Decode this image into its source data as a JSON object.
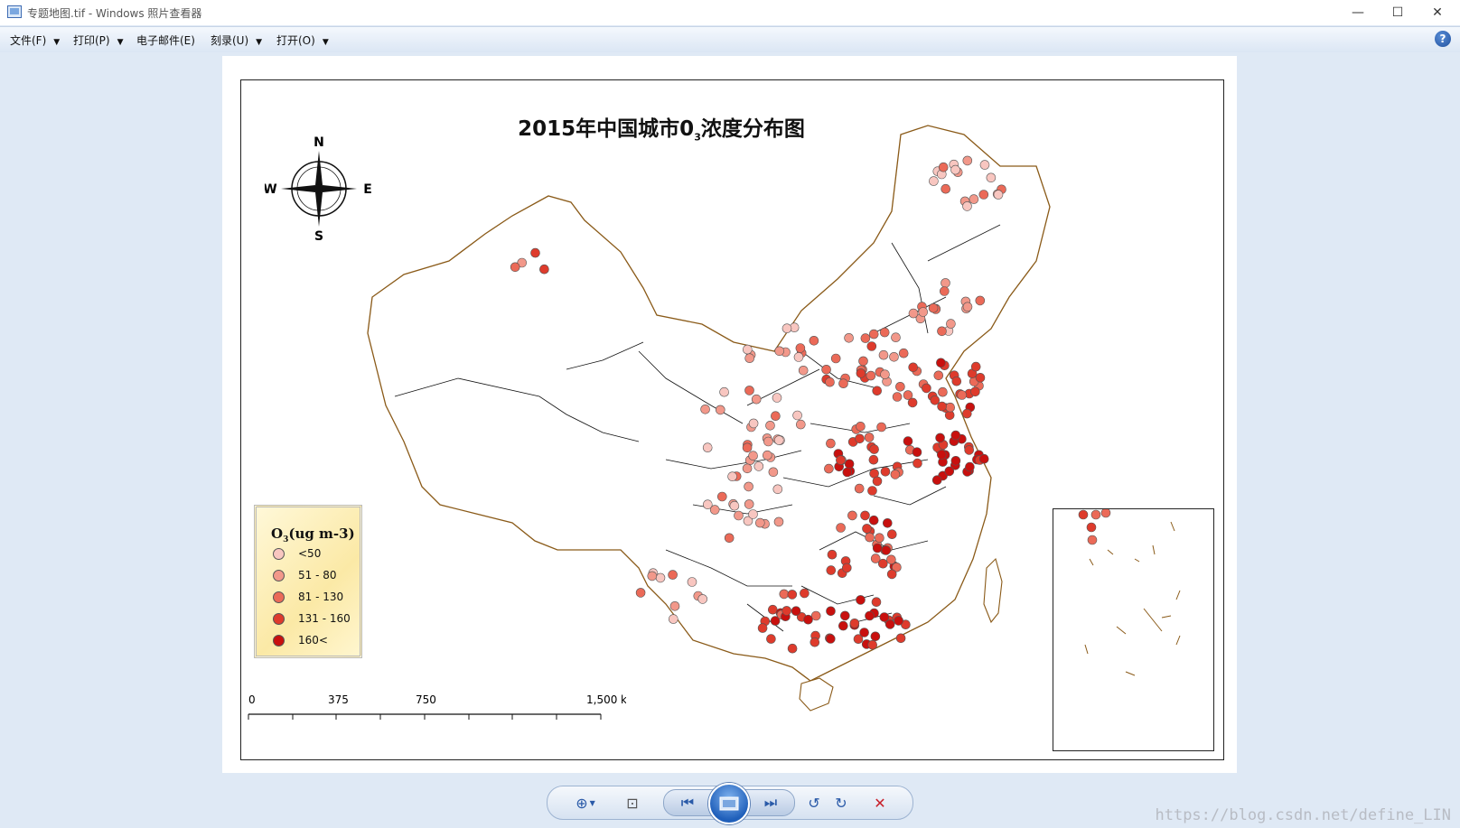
{
  "window": {
    "title": "专题地图.tif - Windows 照片查看器",
    "minimize": "—",
    "maximize": "☐",
    "close": "✕"
  },
  "menu": [
    {
      "label": "文件(F)",
      "has_dropdown": true
    },
    {
      "label": "打印(P)",
      "has_dropdown": true
    },
    {
      "label": "电子邮件(E)",
      "has_dropdown": false
    },
    {
      "label": "刻录(U)",
      "has_dropdown": true
    },
    {
      "label": "打开(O)",
      "has_dropdown": true
    }
  ],
  "help_label": "?",
  "map": {
    "title_main": "2015年中国城市0",
    "title_sub": "3",
    "title_end": "浓度分布图",
    "compass": {
      "n": "N",
      "s": "S",
      "e": "E",
      "w": "W"
    },
    "legend": {
      "title_main": "O",
      "title_sub": "3",
      "title_end": "(ug m-3)",
      "classes": [
        {
          "label": "<50",
          "color": "#f8c6c0"
        },
        {
          "label": "51 - 80",
          "color": "#f2988a"
        },
        {
          "label": "81 - 130",
          "color": "#eb6a58"
        },
        {
          "label": "131 - 160",
          "color": "#de3b2c"
        },
        {
          "label": "160<",
          "color": "#c8100e"
        }
      ]
    },
    "scale": {
      "labels": [
        "0",
        "375",
        "750",
        "1,500"
      ],
      "unit": "km"
    }
  },
  "watermark": "https://blog.csdn.net/define_LIN",
  "toolbar": {
    "zoom": "⊕",
    "fit": "⊡",
    "prev": "⏮",
    "next": "⏭",
    "rotate_ccw": "↺",
    "rotate_cw": "↻",
    "delete": "✕"
  }
}
